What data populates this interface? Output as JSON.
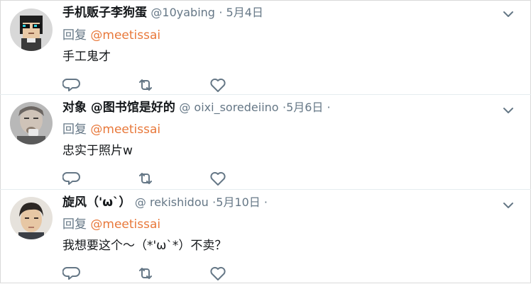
{
  "tweets": [
    {
      "name": "手机贩子李狗蛋",
      "handle": "@10yabing",
      "time": "· 5月4日",
      "reply_prefix": "回复 ",
      "reply_to": "@meetissai",
      "text": "手工鬼才"
    },
    {
      "name": "对象 @图书馆是好的",
      "handle": "@ oixi_soredeiino",
      "time": "·5月6日 ·",
      "reply_prefix": "回复 ",
      "reply_to": "@meetissai",
      "text": "忠实于照片w"
    },
    {
      "name": "旋风（'ω`）",
      "handle": "@ rekishidou",
      "time": "·5月10日 ·",
      "reply_prefix": "回复 ",
      "reply_to": "@meetissai",
      "text": "我想要这个～（*'ω`*）不卖？"
    }
  ],
  "icons": [
    "chevron-down-icon",
    "reply-icon",
    "retweet-icon",
    "like-icon"
  ],
  "colors": {
    "mention": "#e8783a",
    "secondary": "#657786",
    "divider": "#e6ecf0"
  }
}
